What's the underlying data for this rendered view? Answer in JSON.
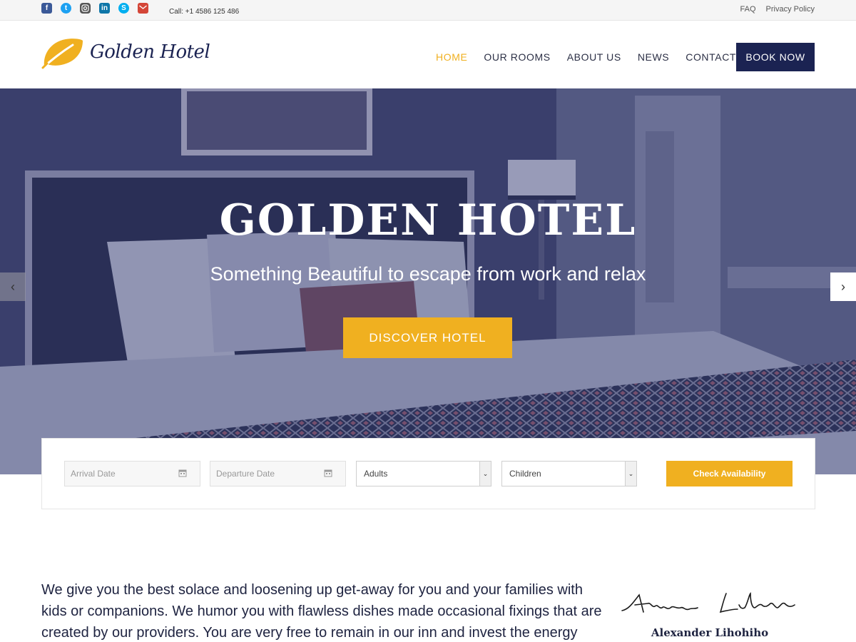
{
  "topbar": {
    "social_icons": [
      "facebook-icon",
      "twitter-icon",
      "instagram-icon",
      "linkedin-icon",
      "skype-icon",
      "mail-icon"
    ],
    "call": "Call: +1 4586 125 486",
    "links": [
      "FAQ",
      "Privacy Policy"
    ]
  },
  "header": {
    "logo_text": "Golden Hotel",
    "nav": [
      "HOME",
      "OUR ROOMS",
      "ABOUT US",
      "NEWS",
      "CONTACT"
    ],
    "active_nav": "HOME",
    "book_button": "BOOK NOW"
  },
  "hero": {
    "title": "GOLDEN HOTEL",
    "subtitle": "Something Beautiful to escape from work and relax",
    "cta": "DISCOVER HOTEL"
  },
  "booking": {
    "arrival_placeholder": "Arrival Date",
    "departure_placeholder": "Departure Date",
    "adults": "Adults",
    "children": "Children",
    "check_button": "Check Availability"
  },
  "intro": {
    "text": "We give you the best solace and loosening up get-away for you and your families with kids or companions. We humor you with flawless dishes made occasional fixings that are created by our providers. You are very free to remain in our inn and invest the energy",
    "signature_name": "Alexander Lihohiho"
  },
  "colors": {
    "accent": "#f0b020",
    "navy": "#1b2352"
  }
}
